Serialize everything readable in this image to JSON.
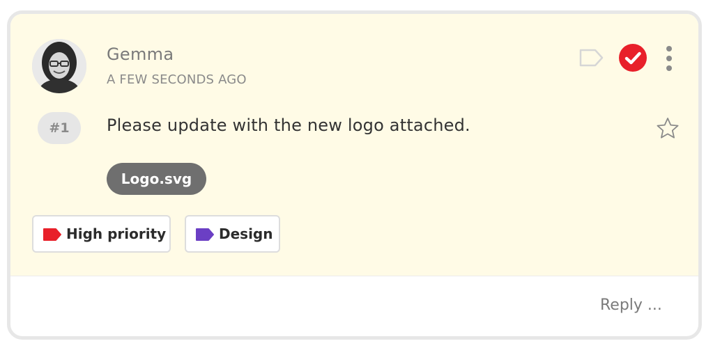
{
  "comment": {
    "author": "Gemma",
    "timestamp": "A FEW SECONDS AGO",
    "number": "#1",
    "message": "Please update with the new logo attached.",
    "attachment": "Logo.svg",
    "resolved": true
  },
  "actions": {
    "tag_icon": "tag-outline-icon",
    "resolve_icon": "check-circle-icon",
    "more_icon": "vertical-dots-icon",
    "star_icon": "star-outline-icon"
  },
  "labels": [
    {
      "text": "High priority",
      "color": "#e8202a",
      "icon": "tag-icon"
    },
    {
      "text": "Design",
      "color": "#6b3fc4",
      "icon": "tag-icon"
    }
  ],
  "reply": {
    "label": "Reply ..."
  },
  "colors": {
    "comment_background": "#fffbe6",
    "resolve": "#e8202a",
    "attachment": "#6f6f6f"
  }
}
